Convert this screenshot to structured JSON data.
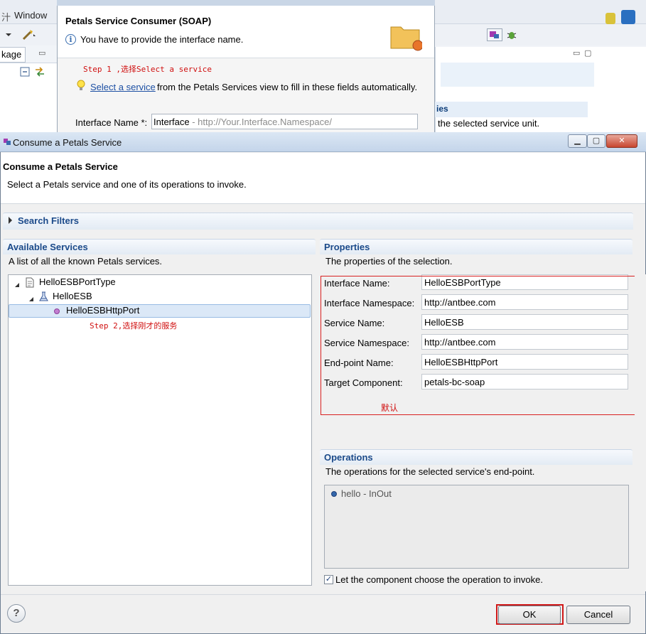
{
  "ide": {
    "menu_partial": "Window",
    "tab_label": "kage"
  },
  "background_panel": {
    "section_title": "ies",
    "description": "the selected service unit."
  },
  "wizard": {
    "title": "Petals Service Consumer (SOAP)",
    "message": "You have to provide the interface name.",
    "step1_annotation": "Step 1 ,选择Select a service",
    "select_link": "Select a service",
    "select_rest": " from the Petals Services view to fill in these fields automatically.",
    "interface_label": "Interface Name *:",
    "interface_value": "Interface",
    "interface_placeholder": "  - http://Your.Interface.Namespace/"
  },
  "dialog": {
    "window_title": "Consume a Petals Service",
    "header_title": "Consume a Petals Service",
    "header_message": "Select a Petals service and one of its operations to invoke.",
    "search_filters": "Search Filters",
    "available": {
      "title": "Available Services",
      "description": "A list of all the known Petals services.",
      "tree": [
        {
          "label": "HelloESBPortType",
          "level": 0,
          "icon": "interface-document-icon"
        },
        {
          "label": "HelloESB",
          "level": 1,
          "icon": "service-flask-icon"
        },
        {
          "label": "HelloESBHttpPort",
          "level": 2,
          "icon": "endpoint-dot-icon",
          "selected": true
        }
      ],
      "step2_annotation": "Step 2,选择刚才的服务"
    },
    "properties": {
      "title": "Properties",
      "description": "The properties of the selection.",
      "fields": [
        {
          "label": "Interface Name:",
          "value": "HelloESBPortType"
        },
        {
          "label": "Interface Namespace:",
          "value": "http://antbee.com"
        },
        {
          "label": "Service Name:",
          "value": "HelloESB"
        },
        {
          "label": "Service Namespace:",
          "value": "http://antbee.com"
        },
        {
          "label": "End-point Name:",
          "value": "HelloESBHttpPort"
        },
        {
          "label": "Target Component:",
          "value": "petals-bc-soap"
        }
      ],
      "default_note": "默认"
    },
    "operations": {
      "title": "Operations",
      "description": "The operations for the selected service's end-point.",
      "items": [
        "hello - InOut"
      ],
      "checkbox_label": "Let the component choose the operation to invoke.",
      "checkbox_checked": true
    },
    "buttons": {
      "help": "?",
      "ok": "OK",
      "cancel": "Cancel"
    }
  },
  "colors": {
    "annotation_red": "#d01010",
    "section_blue": "#1b4a8a",
    "link_blue": "#1c4fa3"
  }
}
